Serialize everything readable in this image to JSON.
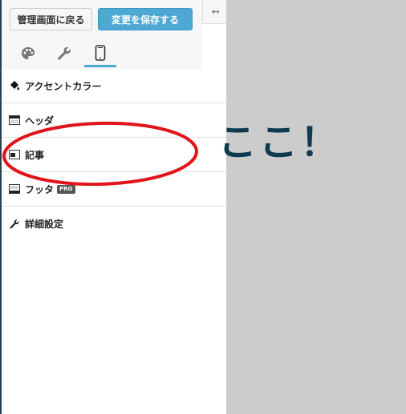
{
  "header": {
    "back_label": "管理画面に戻る",
    "save_label": "変更を保存する",
    "collapse_glyph": "↤"
  },
  "tabs": [
    {
      "icon": "palette-icon",
      "active": false
    },
    {
      "icon": "wrench-icon",
      "active": false
    },
    {
      "icon": "mobile-icon",
      "active": true
    }
  ],
  "sections": [
    {
      "label": "アクセントカラー",
      "icon": "paint-bucket-icon"
    },
    {
      "label": "ヘッダ",
      "icon": "header-layout-icon"
    },
    {
      "label": "記事",
      "icon": "article-layout-icon"
    },
    {
      "label": "フッタ",
      "icon": "footer-layout-icon",
      "badge": "PRO"
    },
    {
      "label": "詳細設定",
      "icon": "wrench-icon"
    }
  ],
  "annotation": {
    "text": "ここ！",
    "color": "#0f3a4f",
    "circle_color": "#e0141a"
  },
  "colors": {
    "accent": "#4ea8d4",
    "preview_bg": "#cccccc"
  }
}
